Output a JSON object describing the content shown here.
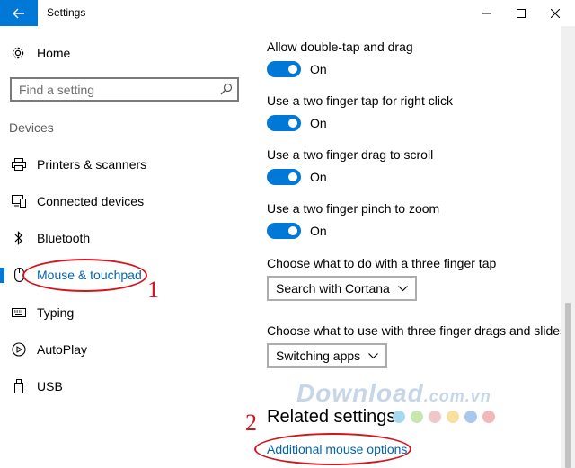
{
  "window": {
    "title": "Settings"
  },
  "sidebar": {
    "home_label": "Home",
    "search_placeholder": "Find a setting",
    "section_label": "Devices",
    "items": [
      {
        "label": "Printers & scanners",
        "icon": "printer-icon"
      },
      {
        "label": "Connected devices",
        "icon": "connected-devices-icon"
      },
      {
        "label": "Bluetooth",
        "icon": "bluetooth-icon"
      },
      {
        "label": "Mouse & touchpad",
        "icon": "mouse-icon",
        "active": true
      },
      {
        "label": "Typing",
        "icon": "keyboard-icon"
      },
      {
        "label": "AutoPlay",
        "icon": "autoplay-icon"
      },
      {
        "label": "USB",
        "icon": "usb-icon"
      }
    ]
  },
  "main": {
    "toggles": [
      {
        "title": "Allow double-tap and drag",
        "state": "On"
      },
      {
        "title": "Use a two finger tap for right click",
        "state": "On"
      },
      {
        "title": "Use a two finger drag to scroll",
        "state": "On"
      },
      {
        "title": "Use a two finger pinch to zoom",
        "state": "On"
      }
    ],
    "three_finger_tap": {
      "title": "Choose what to do with a three finger tap",
      "value": "Search with Cortana"
    },
    "three_finger_drag": {
      "title": "Choose what to use with three finger drags and slides",
      "value": "Switching apps"
    },
    "related_settings_heading": "Related settings",
    "related_link": "Additional mouse options"
  },
  "annotations": {
    "step1": "1",
    "step2": "2"
  },
  "watermark": {
    "text": "Download",
    "suffix": ".com.vn",
    "dot_colors": [
      "#a8d8f0",
      "#c8e6b0",
      "#f0c8c8",
      "#f8e0a0",
      "#a8c8f0",
      "#f0b8b8"
    ]
  },
  "colors": {
    "accent": "#0078d7",
    "link": "#0063b1",
    "annotation": "#d3141e"
  }
}
